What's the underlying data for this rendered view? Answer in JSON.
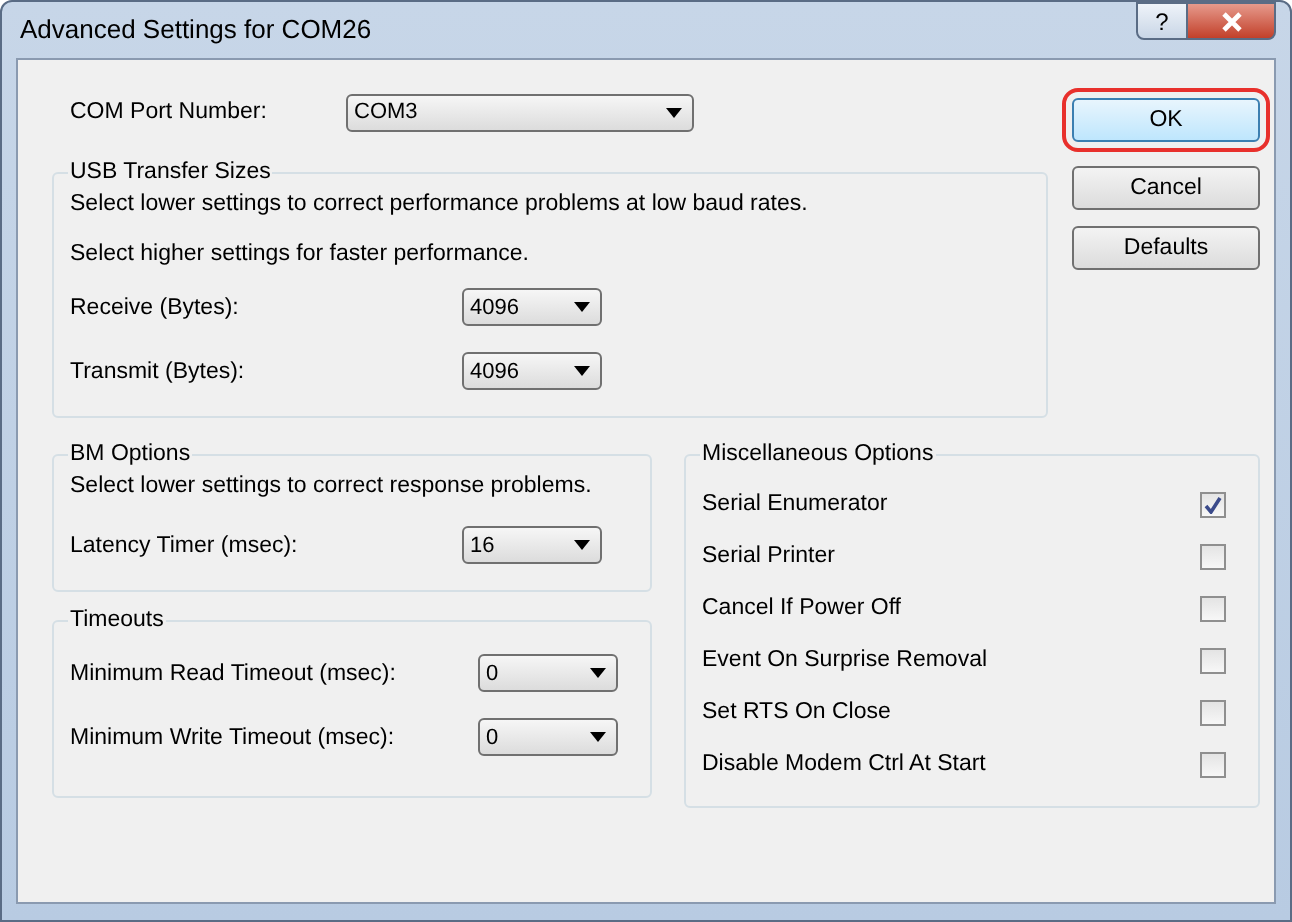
{
  "window": {
    "title": "Advanced Settings for COM26",
    "help_button": "?"
  },
  "com_port": {
    "label": "COM Port Number:",
    "value": "COM3"
  },
  "usb_transfer": {
    "title": "USB Transfer Sizes",
    "notes": [
      "Select lower settings to correct performance problems at low baud rates.",
      "Select higher settings for faster performance."
    ],
    "fields": [
      {
        "label": "Receive (Bytes):",
        "value": "4096"
      },
      {
        "label": "Transmit (Bytes):",
        "value": "4096"
      }
    ]
  },
  "bm_options": {
    "title": "BM Options",
    "note": "Select lower settings to correct response problems.",
    "fields": [
      {
        "label": "Latency Timer (msec):",
        "value": "16"
      }
    ]
  },
  "timeouts": {
    "title": "Timeouts",
    "fields": [
      {
        "label": "Minimum Read Timeout (msec):",
        "value": "0"
      },
      {
        "label": "Minimum Write Timeout (msec):",
        "value": "0"
      }
    ]
  },
  "misc_options": {
    "title": "Miscellaneous Options",
    "items": [
      {
        "label": "Serial Enumerator",
        "checked": true
      },
      {
        "label": "Serial Printer",
        "checked": false
      },
      {
        "label": "Cancel If Power Off",
        "checked": false
      },
      {
        "label": "Event On Surprise Removal",
        "checked": false
      },
      {
        "label": "Set RTS On Close",
        "checked": false
      },
      {
        "label": "Disable Modem Ctrl At Start",
        "checked": false
      }
    ]
  },
  "buttons": [
    {
      "label": "OK",
      "highlighted": true
    },
    {
      "label": "Cancel",
      "highlighted": false
    },
    {
      "label": "Defaults",
      "highlighted": false
    }
  ]
}
